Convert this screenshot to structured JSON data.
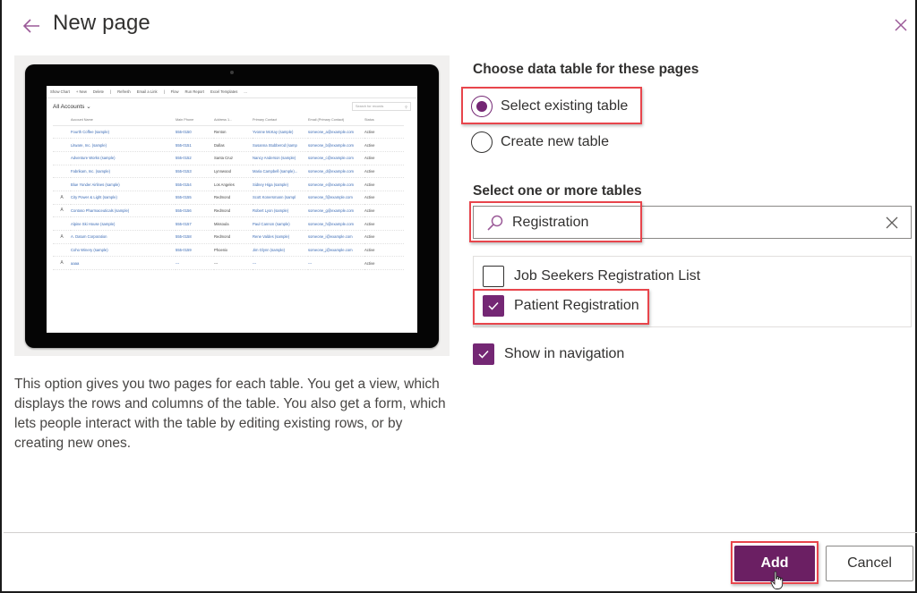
{
  "header": {
    "title": "New page",
    "back_icon": "arrow-left-icon",
    "close_icon": "close-icon"
  },
  "preview": {
    "toolbar": [
      "Show Chart",
      "+ New",
      "Delete",
      "|",
      "Refresh",
      "Email a Link",
      "|",
      "Flow",
      "Run Report",
      "Excel Templates",
      "..."
    ],
    "view_name": "All Accounts",
    "search_placeholder": "Search for records",
    "columns": [
      "",
      "Account Name",
      "Main Phone",
      "Address 1...",
      "Primary Contact",
      "Email (Primary Contact)",
      "Status"
    ],
    "rows": [
      {
        "icon": "",
        "name": "Fourth Coffee (sample)",
        "phone": "555-0150",
        "city": "Renton",
        "contact": "Yvonne McKay (sample)",
        "email": "someone_a@example.com",
        "status": "Active"
      },
      {
        "icon": "",
        "name": "Litware, Inc. (sample)",
        "phone": "555-0151",
        "city": "Dallas",
        "contact": "Susanna Stubberod (samp",
        "email": "someone_b@example.com",
        "status": "Active"
      },
      {
        "icon": "",
        "name": "Adventure Works (sample)",
        "phone": "555-0152",
        "city": "Santa Cruz",
        "contact": "Nancy Anderson (sample)",
        "email": "someone_c@example.com",
        "status": "Active"
      },
      {
        "icon": "",
        "name": "Fabrikam, Inc. (sample)",
        "phone": "555-0153",
        "city": "Lynnwood",
        "contact": "Maria Campbell (sample)...",
        "email": "someone_d@example.com",
        "status": "Active"
      },
      {
        "icon": "",
        "name": "Blue Yonder Airlines (sample)",
        "phone": "555-0154",
        "city": "Los Angeles",
        "contact": "Sidney Higa (sample)",
        "email": "someone_e@example.com",
        "status": "Active"
      },
      {
        "icon": "A",
        "name": "City Power & Light (sample)",
        "phone": "555-0155",
        "city": "Redmond",
        "contact": "Scott Konersmann (sampl",
        "email": "someone_f@example.com",
        "status": "Active"
      },
      {
        "icon": "A",
        "name": "Contoso Pharmaceuticals (sample)",
        "phone": "555-0156",
        "city": "Redmond",
        "contact": "Robert Lyon (sample)",
        "email": "someone_g@example.com",
        "status": "Active"
      },
      {
        "icon": "",
        "name": "Alpine Ski House (sample)",
        "phone": "555-0157",
        "city": "Missoula",
        "contact": "Paul Cannon (sample)",
        "email": "someone_h@example.com",
        "status": "Active"
      },
      {
        "icon": "A",
        "name": "A. Datum Corporation",
        "phone": "555-0158",
        "city": "Redmond",
        "contact": "Rene Valdes (sample)",
        "email": "someone_i@example.com",
        "status": "Active"
      },
      {
        "icon": "",
        "name": "Coho Winery (sample)",
        "phone": "555-0159",
        "city": "Phoenix",
        "contact": "Jim Glynn (sample)",
        "email": "someone_j@example.com",
        "status": "Active"
      },
      {
        "icon": "A",
        "name": "aaaa",
        "phone": "---",
        "city": "---",
        "contact": "---",
        "email": "---",
        "status": "Active"
      }
    ]
  },
  "description": "This option gives you two pages for each table. You get a view, which displays the rows and columns of the table. You also get a form, which lets people interact with the table by editing existing rows, or by creating new ones.",
  "data_table": {
    "label": "Choose data table for these pages",
    "options": [
      {
        "label": "Select existing table",
        "checked": true
      },
      {
        "label": "Create new table",
        "checked": false
      }
    ]
  },
  "tables": {
    "label": "Select one or more tables",
    "search_value": "Registration",
    "search_icon": "search-icon",
    "clear_icon": "clear-icon",
    "items": [
      {
        "label": "Job Seekers Registration List",
        "checked": false
      },
      {
        "label": "Patient Registration",
        "checked": true
      }
    ]
  },
  "show_in_navigation": {
    "label": "Show in navigation",
    "checked": true
  },
  "footer": {
    "add_label": "Add",
    "cancel_label": "Cancel"
  },
  "colors": {
    "accent": "#742774",
    "primary_button": "#6b1f63",
    "highlight": "#e8454c"
  }
}
